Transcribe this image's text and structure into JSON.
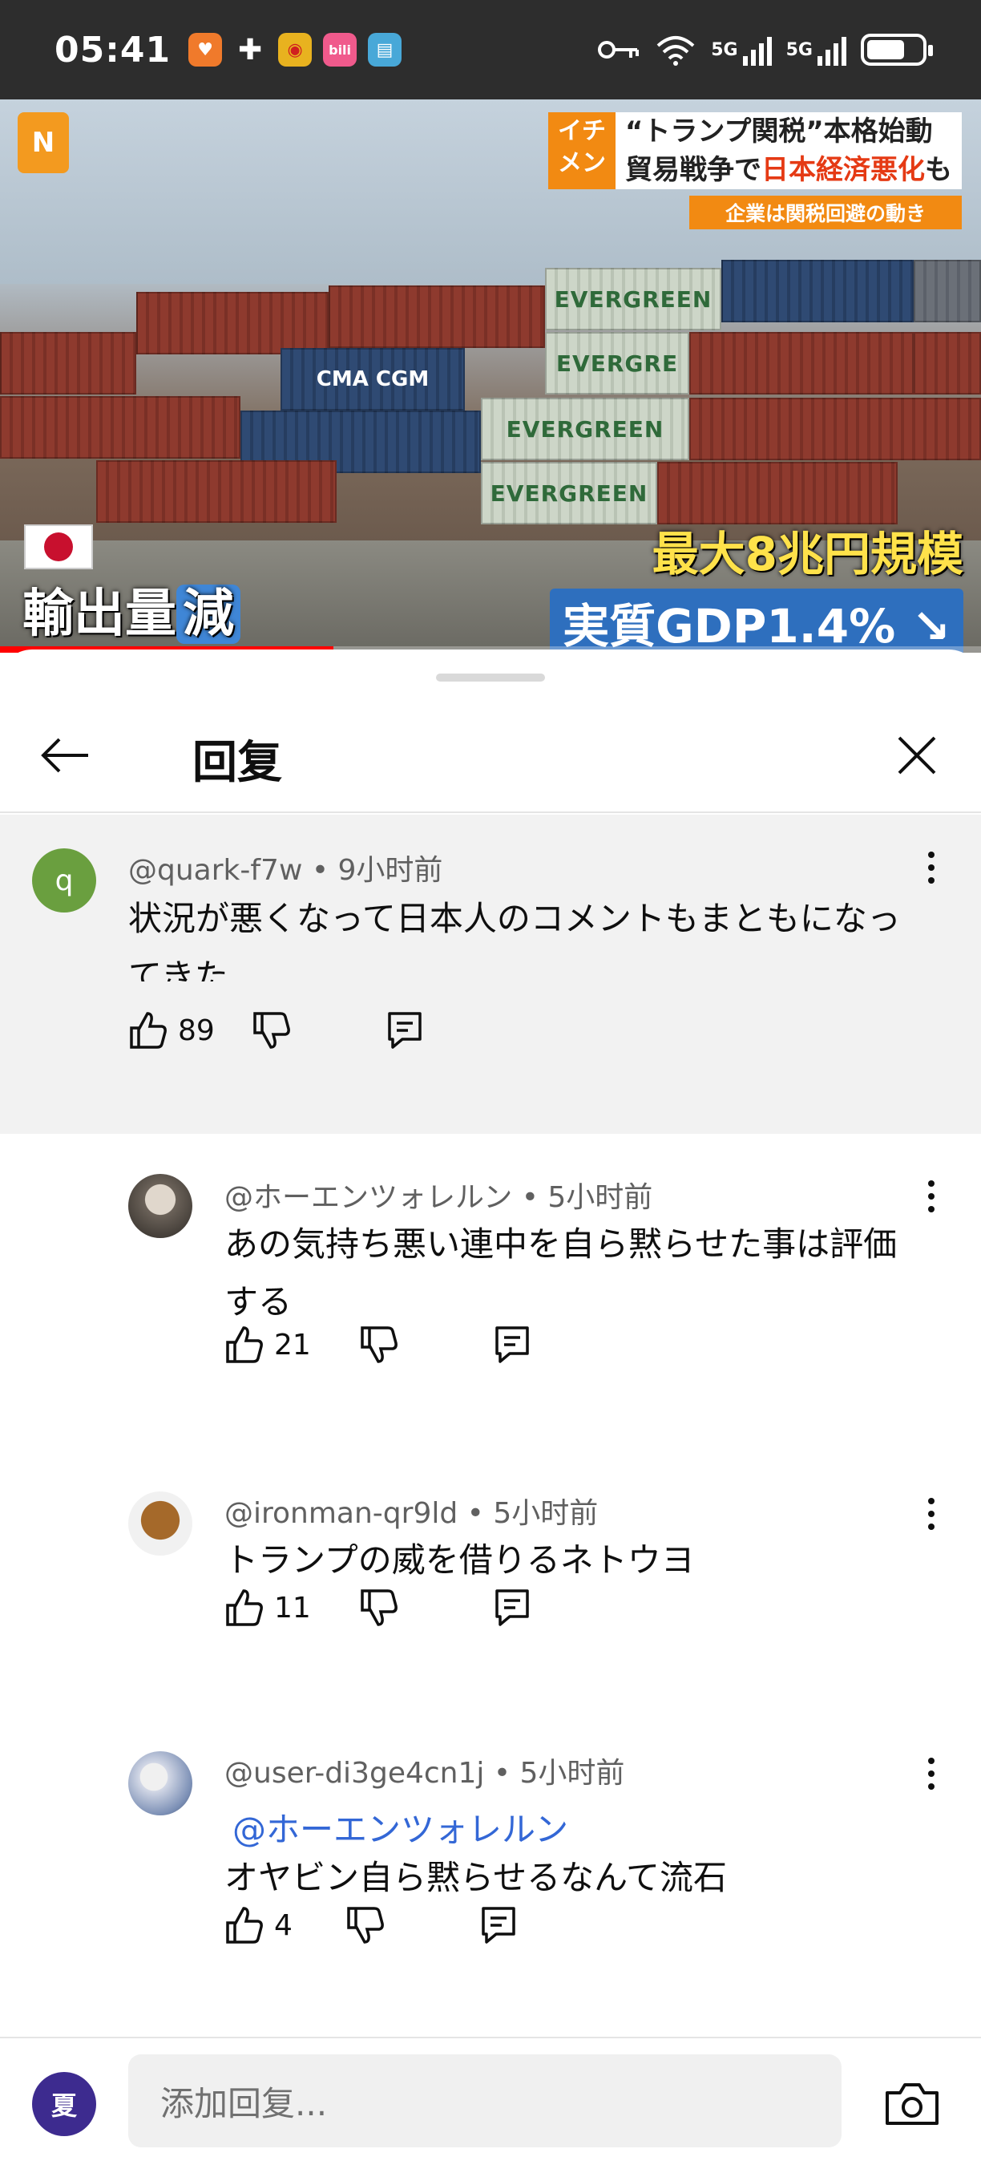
{
  "status_bar": {
    "time": "05:41",
    "network_1": "5G",
    "network_2": "5G",
    "battery_percent": 70
  },
  "video": {
    "channel_logo": "N",
    "headline_tag": "イチ\nメン",
    "headline_line1_prefix": "“トランプ関税”",
    "headline_line1_suffix": "本格始動",
    "headline_line2_a": "貿易戦争で",
    "headline_line2_b": "日本経済悪化",
    "headline_line2_c": "も",
    "headline_sub": "企業は関税回避の動き",
    "caption_left_a": "輸出量",
    "caption_left_b": "減",
    "caption_right_1": "最大8兆円規模",
    "caption_right_2": "実質GDP1.4%",
    "container_text_1": "EVERGREEN",
    "container_text_2": "EVERGRE",
    "container_text_3": "CMA CGM",
    "progress_fraction": 0.34
  },
  "sheet": {
    "title": "回复"
  },
  "comments": [
    {
      "author": "@quark-f7w",
      "time": "9小时前",
      "text": "状況が悪くなって日本人のコメントもまともになってきた",
      "likes": "89",
      "avatar_letter": "q",
      "avatar_color": "#6a9f3f"
    },
    {
      "author": "@ホーエンツォレルン",
      "time": "5小时前",
      "text": "あの気持ち悪い連中を自ら黙らせた事は評価する",
      "likes": "21"
    },
    {
      "author": "@ironman-qr9ld",
      "time": "5小时前",
      "text": "トランプの威を借りるネトウヨ",
      "likes": "11"
    },
    {
      "author": "@user-di3ge4cn1j",
      "time": "5小时前",
      "mention": "@ホーエンツォレルン",
      "text": "オヤビン自ら黙らせるなんて流石",
      "likes": "4"
    }
  ],
  "bottom_bar": {
    "avatar_letter": "夏",
    "placeholder": "添加回复..."
  }
}
